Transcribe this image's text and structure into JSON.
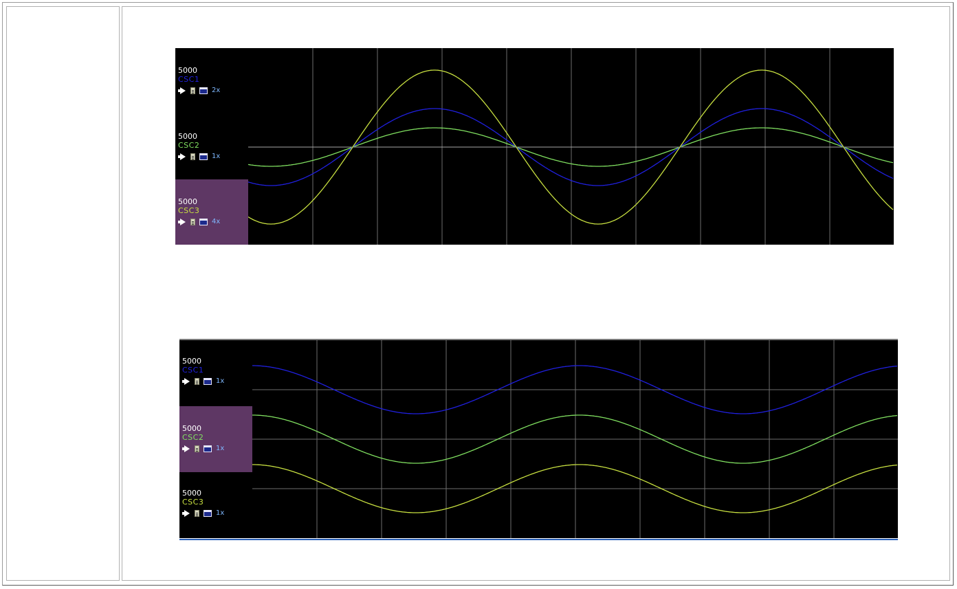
{
  "colors": {
    "background": "#000000",
    "grid": "#6e6e6e",
    "selected_panel": "#5e3764",
    "scale_text": "#ffffff",
    "zoom_text": "#7fb8ff"
  },
  "icons": [
    "speaker-icon",
    "meter-icon",
    "window-icon"
  ],
  "scopes": [
    {
      "mode": "overlay",
      "selected_channel": 2,
      "channels": [
        {
          "scale": "5000",
          "name": "CSC1",
          "color": "#2020e0",
          "zoom": "2x",
          "amplitude": 2
        },
        {
          "scale": "5000",
          "name": "CSC2",
          "color": "#80e060",
          "zoom": "1x",
          "amplitude": 1
        },
        {
          "scale": "5000",
          "name": "CSC3",
          "color": "#c8e040",
          "zoom": "4x",
          "amplitude": 4
        }
      ]
    },
    {
      "mode": "stacked",
      "selected_channel": 1,
      "channels": [
        {
          "scale": "5000",
          "name": "CSC1",
          "color": "#2020e0",
          "zoom": "1x",
          "amplitude": 1
        },
        {
          "scale": "5000",
          "name": "CSC2",
          "color": "#80e060",
          "zoom": "1x",
          "amplitude": 1
        },
        {
          "scale": "5000",
          "name": "CSC3",
          "color": "#c8e040",
          "zoom": "1x",
          "amplitude": 1
        }
      ]
    }
  ]
}
